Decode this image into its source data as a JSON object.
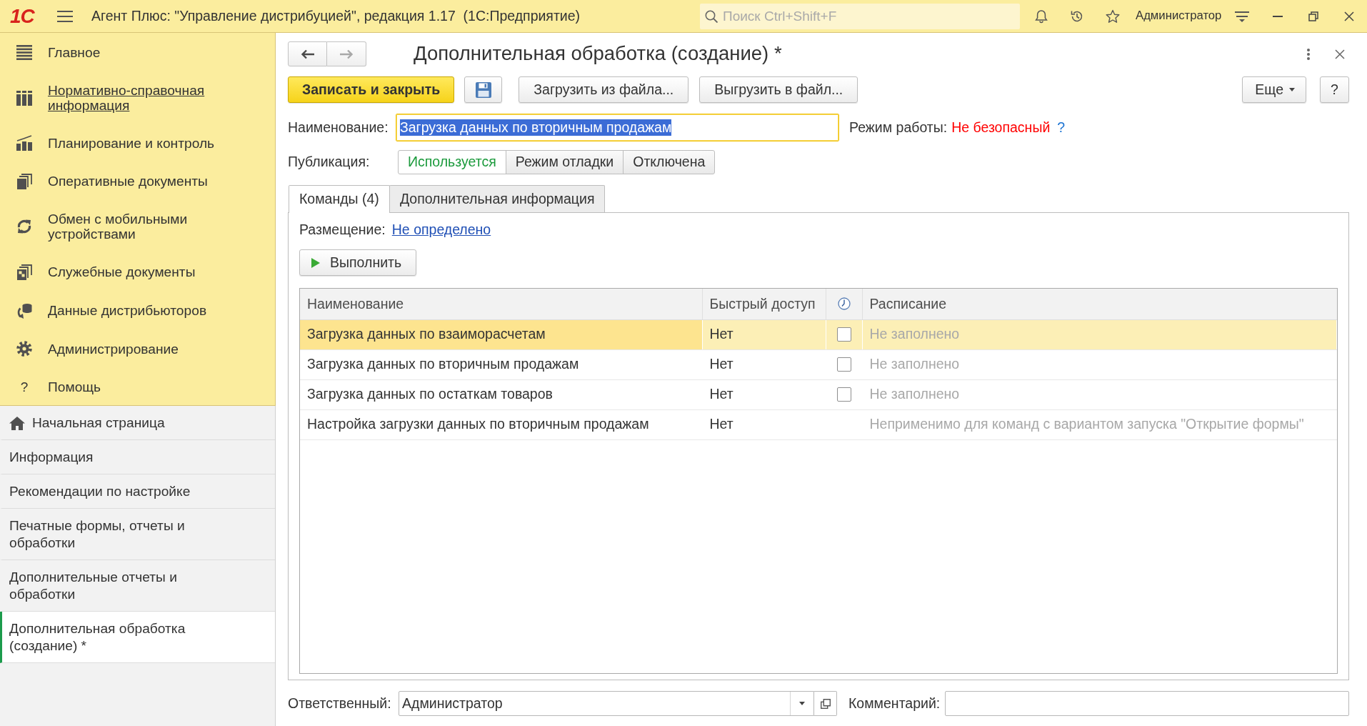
{
  "title_bar": {
    "logo": "1С",
    "title": "Агент Плюс: \"Управление дистрибуцией\", редакция 1.17  (1С:Предприятие)",
    "search": {
      "placeholder": "Поиск Ctrl+Shift+F"
    },
    "user": "Администратор"
  },
  "sections_panel": {
    "items": [
      {
        "label": "Главное",
        "hovered": false
      },
      {
        "label": "Нормативно-справочная информация",
        "hovered": true
      },
      {
        "label": "Планирование и контроль",
        "hovered": false
      },
      {
        "label": "Оперативные документы",
        "hovered": false
      },
      {
        "label": "Обмен с мобильными устройствами",
        "hovered": false
      },
      {
        "label": "Служебные документы",
        "hovered": false
      },
      {
        "label": "Данные дистрибьюторов",
        "hovered": false
      },
      {
        "label": "Администрирование",
        "hovered": false
      },
      {
        "label": "Помощь",
        "glyph": "?",
        "hovered": false
      }
    ]
  },
  "open_windows": {
    "items": [
      {
        "label": "Начальная страница",
        "kind": "home",
        "selected": false
      },
      {
        "label": "Информация",
        "kind": "page",
        "selected": false
      },
      {
        "label": "Рекомендации по настройке",
        "kind": "page",
        "selected": false
      },
      {
        "label": "Печатные формы, отчеты и обработки",
        "kind": "page",
        "selected": false
      },
      {
        "label": "Дополнительные отчеты и обработки",
        "kind": "page",
        "selected": false
      },
      {
        "label": "Дополнительная обработка (создание) *",
        "kind": "page",
        "selected": true
      }
    ]
  },
  "form": {
    "title": "Дополнительная обработка (создание) *",
    "nav": [
      {
        "disabled": false
      },
      {
        "disabled": true
      }
    ],
    "toolbar": {
      "buttons": [
        {
          "kind": "primary",
          "label": "Записать и закрыть"
        },
        {
          "kind": "save"
        },
        {
          "kind": "default",
          "label": "Загрузить из файла..."
        },
        {
          "kind": "default",
          "label": "Выгрузить в файл..."
        }
      ],
      "more": "Еще",
      "help": "?"
    },
    "name_field": {
      "label": "Наименование:",
      "value": "Загрузка данных по вторичным продажам",
      "focused": true
    },
    "mode": {
      "label": "Режим работы:",
      "value": "Не безопасный",
      "help": "?"
    },
    "publication": {
      "label": "Публикация:",
      "options": [
        {
          "label": "Используется",
          "selected": true
        },
        {
          "label": "Режим отладки",
          "selected": false
        },
        {
          "label": "Отключена",
          "selected": false
        }
      ]
    },
    "tabs": [
      {
        "label": "Команды (4)",
        "selected": true
      },
      {
        "label": "Дополнительная информация",
        "selected": false
      }
    ],
    "placement": {
      "label": "Размещение:",
      "link": "Не определено"
    },
    "run_button": "Выполнить",
    "table": {
      "columns": [
        {
          "kind": "text",
          "label": "Наименование"
        },
        {
          "kind": "text",
          "label": "Быстрый доступ"
        },
        {
          "kind": "icon"
        },
        {
          "kind": "text",
          "label": "Расписание"
        }
      ],
      "rows": [
        {
          "name": "Загрузка данных по взаиморасчетам",
          "quick_access": "Нет",
          "kind": "toggle",
          "checked": false,
          "schedule": "Не заполнено",
          "selected": true
        },
        {
          "name": "Загрузка данных по вторичным продажам",
          "quick_access": "Нет",
          "kind": "toggle",
          "checked": false,
          "schedule": "Не заполнено",
          "selected": false
        },
        {
          "name": "Загрузка данных по остаткам товаров",
          "quick_access": "Нет",
          "kind": "toggle",
          "checked": false,
          "schedule": "Не заполнено",
          "selected": false
        },
        {
          "name": "Настройка загрузки данных по вторичным продажам",
          "quick_access": "Нет",
          "kind": "plain",
          "schedule": "Неприменимо для команд с вариантом запуска \"Открытие формы\"",
          "selected": false
        }
      ]
    },
    "responsible": {
      "label": "Ответственный:",
      "value": "Администратор"
    },
    "comment": {
      "label": "Комментарий:"
    }
  }
}
